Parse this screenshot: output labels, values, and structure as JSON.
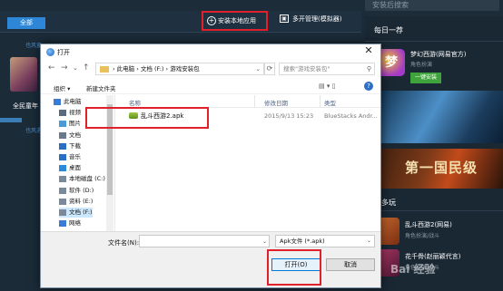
{
  "background_app": {
    "search_placeholder": "安装后搜索",
    "tab_all": "全部",
    "install_local": "安装本地应用",
    "multi_manager": "多开管理(模拟器)",
    "left_link_1": "也风童",
    "left_link_2": "也风遇",
    "left_app_label": "全民童年",
    "right_panel": {
      "title": "每日一荐",
      "game1_name": "梦幻西游(网易官方)",
      "game1_sub": "角色扮演",
      "game1_button": "一键安装",
      "banner2_text": "第一国民级",
      "section_more": "更多玩",
      "game2_name": "乱斗西游2(网易)",
      "game2_sub": "角色扮演/战斗",
      "game3_name": "花千骨(赵丽颖代言)",
      "game3_sub": "角色扮演/战斗"
    },
    "watermark": "Bai 经验"
  },
  "dialog": {
    "title": "打开",
    "close": "✕",
    "nav": {
      "back": "←",
      "forward": "→",
      "up_dropdown": "⌄",
      "up": "↑"
    },
    "address": "› 此电脑 › 文档 (F:) › 游戏安装包",
    "address_dropdown": "⌄",
    "refresh": "⟳",
    "search_placeholder": "搜索\"游戏安装包\"",
    "toolbar": {
      "organize": "组织 ▾",
      "new_folder": "新建文件夹",
      "view": "▤ ▾ ▯",
      "help": "?"
    },
    "tree": [
      {
        "label": "此电脑",
        "icon": "pc-icon",
        "kind": "pc"
      },
      {
        "label": "视频",
        "icon": "video-icon"
      },
      {
        "label": "图片",
        "icon": "picture-icon"
      },
      {
        "label": "文档",
        "icon": "document-icon"
      },
      {
        "label": "下载",
        "icon": "download-icon"
      },
      {
        "label": "音乐",
        "icon": "music-icon"
      },
      {
        "label": "桌面",
        "icon": "desktop-icon"
      },
      {
        "label": "本地磁盘 (C:)",
        "icon": "drive-icon"
      },
      {
        "label": "软件 (D:)",
        "icon": "drive-icon"
      },
      {
        "label": "资料 (E:)",
        "icon": "drive-icon"
      },
      {
        "label": "文档 (F:)",
        "icon": "drive-icon",
        "selected": true
      },
      {
        "label": "网络",
        "icon": "network-icon"
      }
    ],
    "columns": {
      "name": "名称",
      "date": "修改日期",
      "type": "类型"
    },
    "file": {
      "name": "乱斗西游2.apk",
      "date": "2015/9/13 15:23",
      "type": "BlueStacks Andr..."
    },
    "filename_label": "文件名(N):",
    "filename_value": "",
    "filename_dropdown": "⌄",
    "filetype": "Apk文件 (*.apk)",
    "filetype_arrow": "⌄",
    "open_button": "打开(O)",
    "cancel_button": "取消"
  },
  "colors": {
    "highlight": "#e0202a",
    "accent": "#2d87d6"
  }
}
